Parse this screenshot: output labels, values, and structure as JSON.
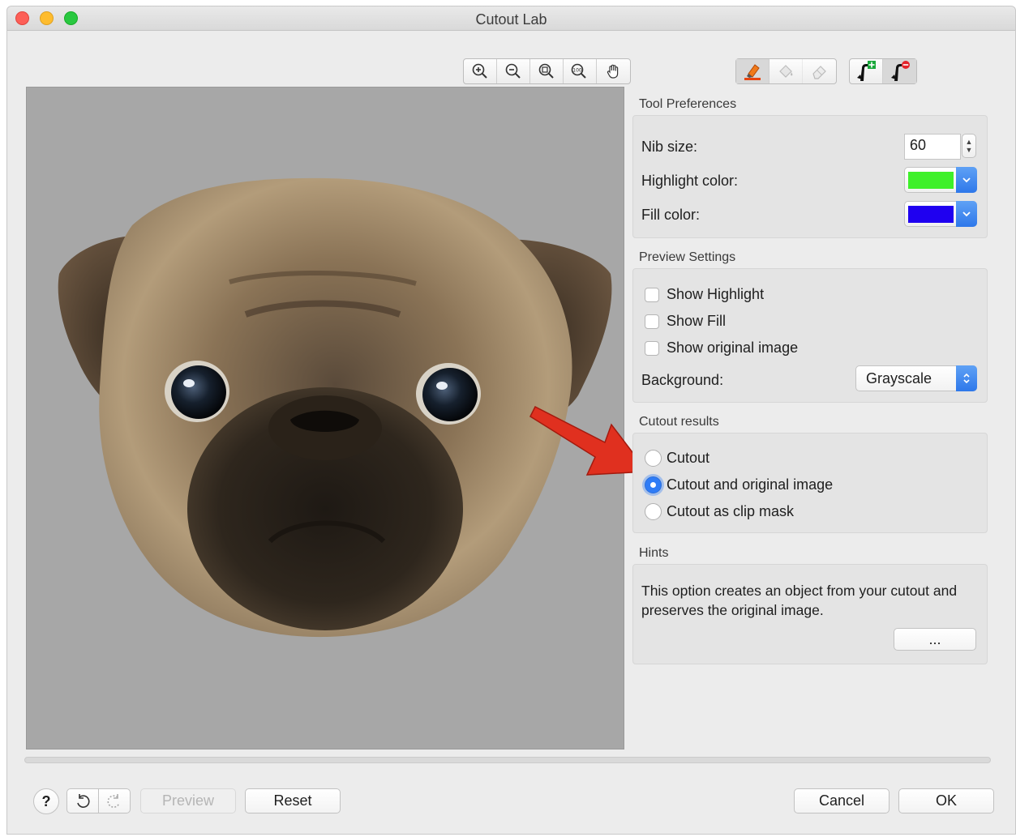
{
  "window": {
    "title": "Cutout Lab"
  },
  "view_toolbar": {
    "buttons": [
      {
        "icon": "zoom-in-icon"
      },
      {
        "icon": "zoom-out-icon"
      },
      {
        "icon": "zoom-fit-icon"
      },
      {
        "icon": "zoom-100-icon",
        "text": "100"
      },
      {
        "icon": "hand-pan-icon"
      }
    ]
  },
  "tool_toolbar": {
    "buttons": [
      {
        "icon": "highlighter-icon",
        "state": "active"
      },
      {
        "icon": "fill-bucket-icon",
        "state": "disabled"
      },
      {
        "icon": "eraser-icon",
        "state": "disabled"
      }
    ]
  },
  "mode_toolbar": {
    "buttons": [
      {
        "icon": "add-detail-icon"
      },
      {
        "icon": "remove-detail-icon",
        "state": "pressed"
      }
    ]
  },
  "tool_preferences": {
    "heading": "Tool Preferences",
    "nib_size_label": "Nib size:",
    "nib_size_value": "60",
    "highlight_color_label": "Highlight color:",
    "highlight_color": "#3ef02a",
    "fill_color_label": "Fill color:",
    "fill_color": "#1f00f0"
  },
  "preview_settings": {
    "heading": "Preview Settings",
    "show_highlight": "Show Highlight",
    "show_fill": "Show Fill",
    "show_original": "Show original image",
    "background_label": "Background:",
    "background_value": "Grayscale"
  },
  "cutout_results": {
    "heading": "Cutout results",
    "options": [
      "Cutout",
      "Cutout and original image",
      "Cutout as clip mask"
    ],
    "selected": 1
  },
  "hints": {
    "heading": "Hints",
    "text": "This option creates an object from your cutout and preserves the original image.",
    "more_button": "..."
  },
  "footer": {
    "help": "?",
    "preview": "Preview",
    "reset": "Reset",
    "cancel": "Cancel",
    "ok": "OK"
  },
  "colors": {
    "accent": "#2f7cf6",
    "annotation_arrow": "#e0301f",
    "canvas_bg": "#a7a7a7"
  }
}
